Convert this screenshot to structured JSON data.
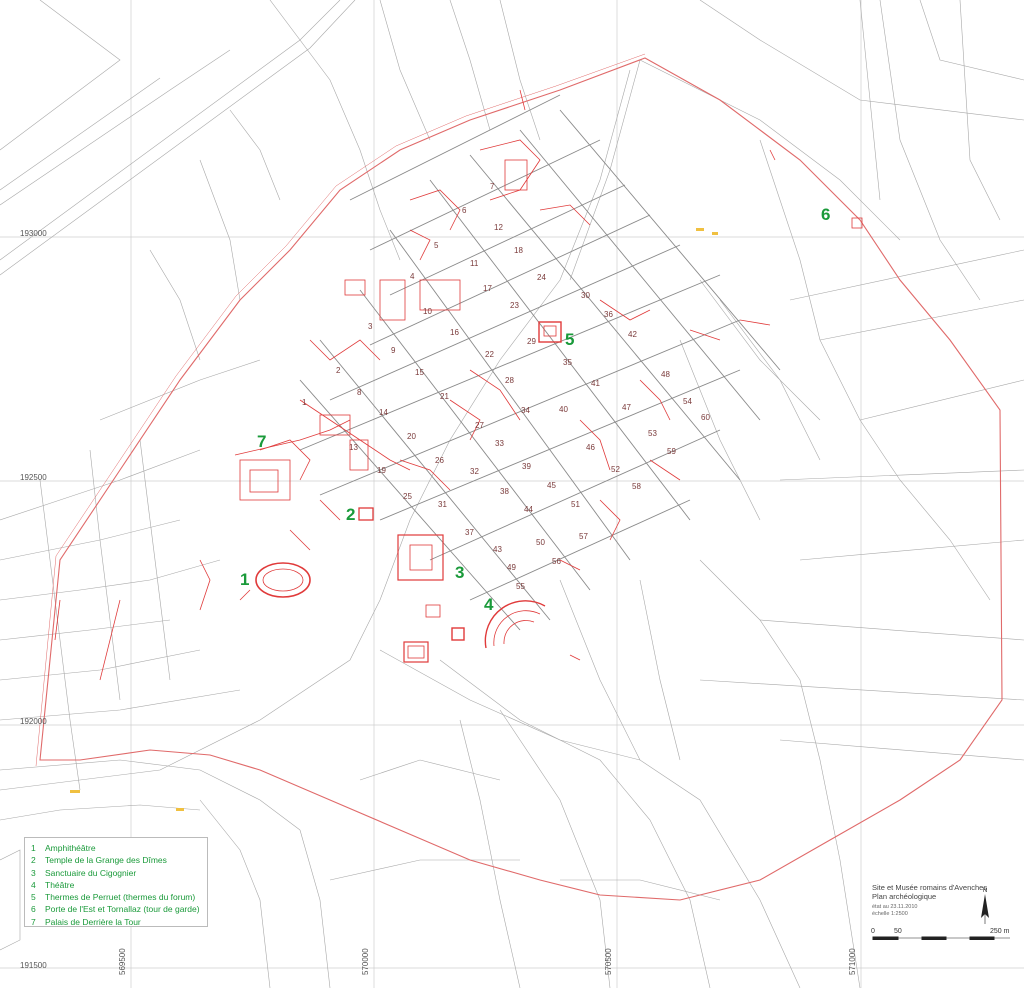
{
  "grid": {
    "y_labels": [
      "193000",
      "192500",
      "192000",
      "191500"
    ],
    "x_labels": [
      "569500",
      "570000",
      "570500",
      "571000"
    ]
  },
  "monuments": [
    {
      "number": "1",
      "name": "Amphithéâtre"
    },
    {
      "number": "2",
      "name": "Temple de la Grange des Dîmes"
    },
    {
      "number": "3",
      "name": "Sanctuaire du Cigognier"
    },
    {
      "number": "4",
      "name": "Théâtre"
    },
    {
      "number": "5",
      "name": "Thermes de Perruet (thermes du forum)"
    },
    {
      "number": "6",
      "name": "Porte de l'Est et Tornallaz (tour de garde)"
    },
    {
      "number": "7",
      "name": "Palais de Derrière la Tour"
    }
  ],
  "insulae": [
    "1",
    "2",
    "3",
    "4",
    "5",
    "6",
    "7",
    "8",
    "9",
    "10",
    "11",
    "12",
    "13",
    "14",
    "15",
    "16",
    "17",
    "18",
    "19",
    "20",
    "21",
    "22",
    "23",
    "24",
    "25",
    "26",
    "27",
    "28",
    "29",
    "30",
    "31",
    "32",
    "33",
    "34",
    "35",
    "36",
    "37",
    "38",
    "39",
    "40",
    "41",
    "42",
    "43",
    "44",
    "45",
    "46",
    "47",
    "48",
    "49",
    "50",
    "51",
    "52",
    "53",
    "54",
    "55",
    "56",
    "57",
    "58",
    "59",
    "60"
  ],
  "info": {
    "title_line1": "Site et Musée romains d'Avenches",
    "title_line2": "Plan archéologique",
    "state": "état au 23.11.2010",
    "scale": "échelle 1:2500"
  },
  "scalebar": {
    "start": "0",
    "mid": "50",
    "end": "250 m"
  },
  "north": "N",
  "colors": {
    "monument_label": "#1a9a3a",
    "remains": "#e03a3a",
    "grid": "#c8c8c8",
    "insula_label": "#7a3a3a"
  }
}
